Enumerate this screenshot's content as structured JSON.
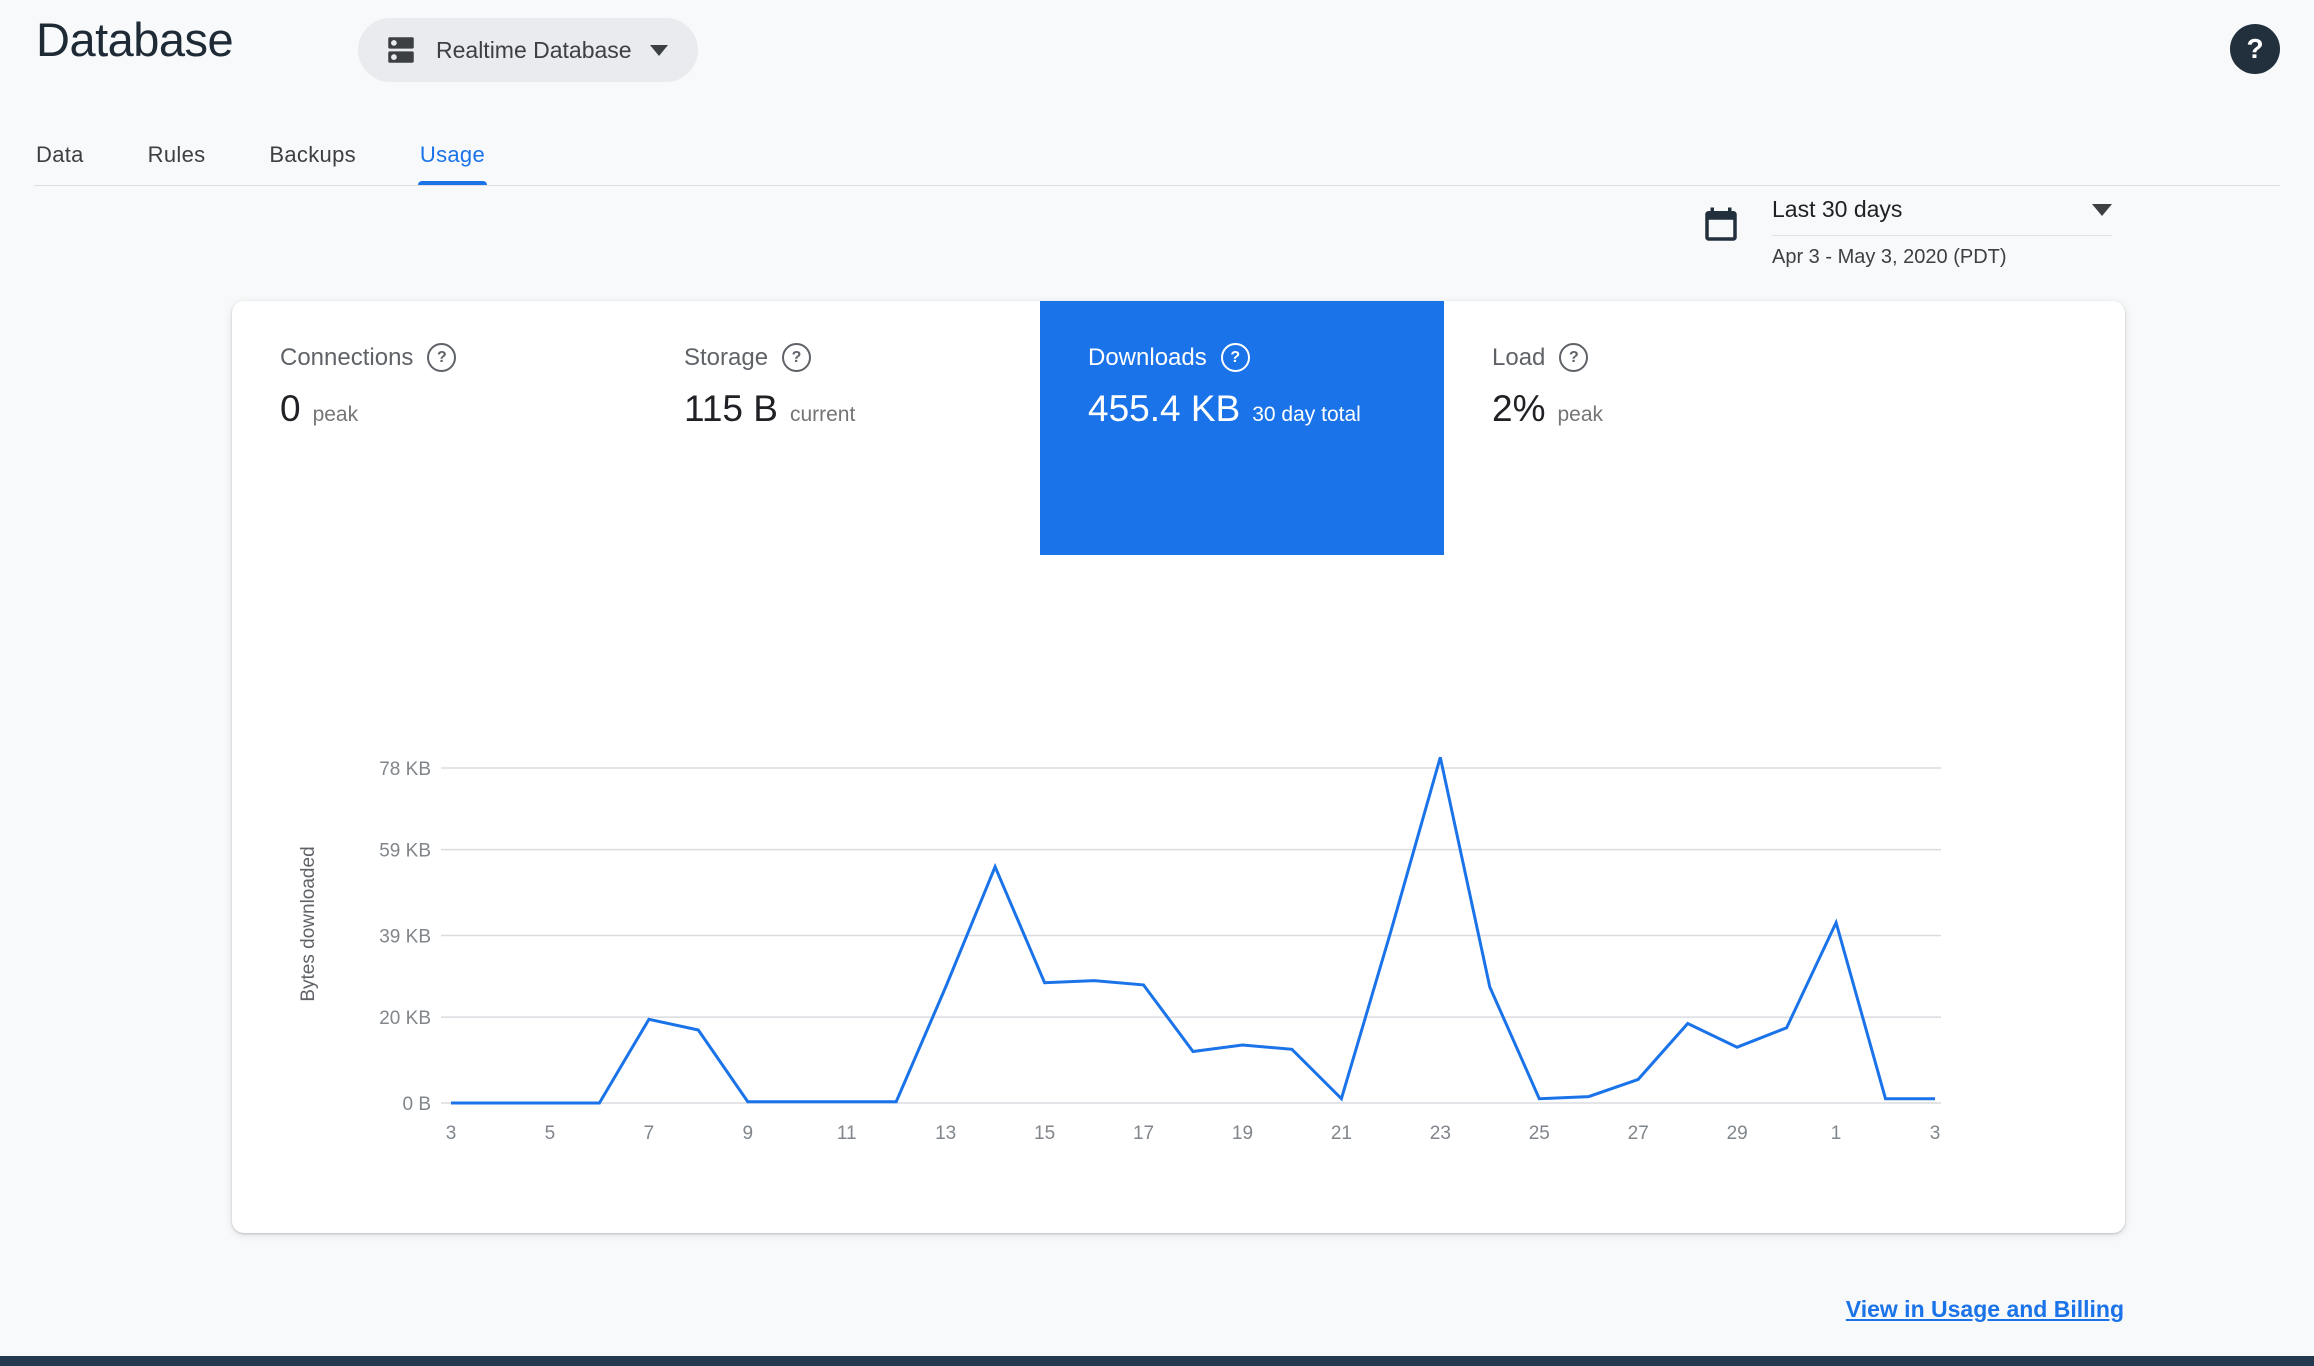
{
  "colors": {
    "accent": "#1a73e8",
    "selected_tile": "#1a73e8",
    "line": "#1a73e8",
    "grid": "#dadce0",
    "page_bg": "#f8f9fa",
    "bottom_bar": "#233950"
  },
  "header": {
    "title": "Database",
    "database_selector": "Realtime Database",
    "help_glyph": "?"
  },
  "nav_tabs": [
    {
      "label": "Data"
    },
    {
      "label": "Rules"
    },
    {
      "label": "Backups"
    },
    {
      "label": "Usage"
    }
  ],
  "active_tab": "Usage",
  "date_range": {
    "label": "Last 30 days",
    "detail": "Apr 3 - May 3, 2020 (PDT)"
  },
  "metric_tabs": [
    {
      "label": "Connections",
      "help_glyph": "?",
      "value": "0",
      "unit": "peak",
      "selected": false
    },
    {
      "label": "Storage",
      "help_glyph": "?",
      "value": "115 B",
      "unit": "current",
      "selected": false
    },
    {
      "label": "Downloads",
      "help_glyph": "?",
      "value": "455.4 KB",
      "unit": "30 day total",
      "selected": true
    },
    {
      "label": "Load",
      "help_glyph": "?",
      "value": "2%",
      "unit": "peak",
      "selected": false
    }
  ],
  "chart_data": {
    "type": "line",
    "title": "",
    "ylabel": "Bytes downloaded",
    "xlabel": "",
    "unit": "KB",
    "x_range": "Apr 3 - May 3, 2020",
    "x_days": [
      3,
      4,
      5,
      6,
      7,
      8,
      9,
      10,
      11,
      12,
      13,
      14,
      15,
      16,
      17,
      18,
      19,
      20,
      21,
      22,
      23,
      24,
      25,
      26,
      27,
      28,
      29,
      30,
      1,
      2,
      3
    ],
    "values_kb": [
      0,
      0,
      0,
      0,
      19.5,
      17,
      0.3,
      0.3,
      0.3,
      0.3,
      27,
      55,
      28,
      28.5,
      27.5,
      12,
      13.5,
      12.5,
      1,
      40,
      80.5,
      27,
      1,
      1.5,
      5.5,
      18.5,
      13,
      17.5,
      42,
      1,
      1
    ],
    "x_tick_labels": [
      "3",
      "5",
      "7",
      "9",
      "11",
      "13",
      "15",
      "17",
      "19",
      "21",
      "23",
      "25",
      "27",
      "29",
      "1",
      "3"
    ],
    "y_ticks": [
      {
        "label": "0 B",
        "value": 0
      },
      {
        "label": "20 KB",
        "value": 20
      },
      {
        "label": "39 KB",
        "value": 39
      },
      {
        "label": "59 KB",
        "value": 59
      },
      {
        "label": "78 KB",
        "value": 78
      }
    ],
    "ylim": [
      0,
      84
    ],
    "grid": true,
    "legend": false,
    "line_color": "#1a73e8"
  },
  "footer": {
    "link_label": "View in Usage and Billing"
  }
}
